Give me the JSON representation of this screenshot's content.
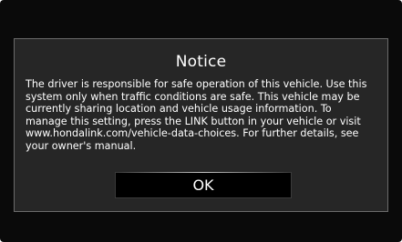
{
  "dialog": {
    "title": "Notice",
    "lines": [
      "The driver is responsible for safe operation of this vehicle. Use this",
      "system only when traffic conditions are safe. This vehicle may be",
      "currently sharing location and vehicle usage information. To",
      "manage this setting, press the LINK button in your vehicle or visit",
      "www.hondalink.com/vehicle-data-choices. For further details, see",
      "your owner's manual."
    ],
    "ok_label": "OK"
  },
  "colors": {
    "screen_background": "#0a0a0a",
    "dialog_background": "#262626",
    "dialog_border": "#6b6b6b",
    "text": "#ffffff",
    "button_background": "#000000"
  }
}
